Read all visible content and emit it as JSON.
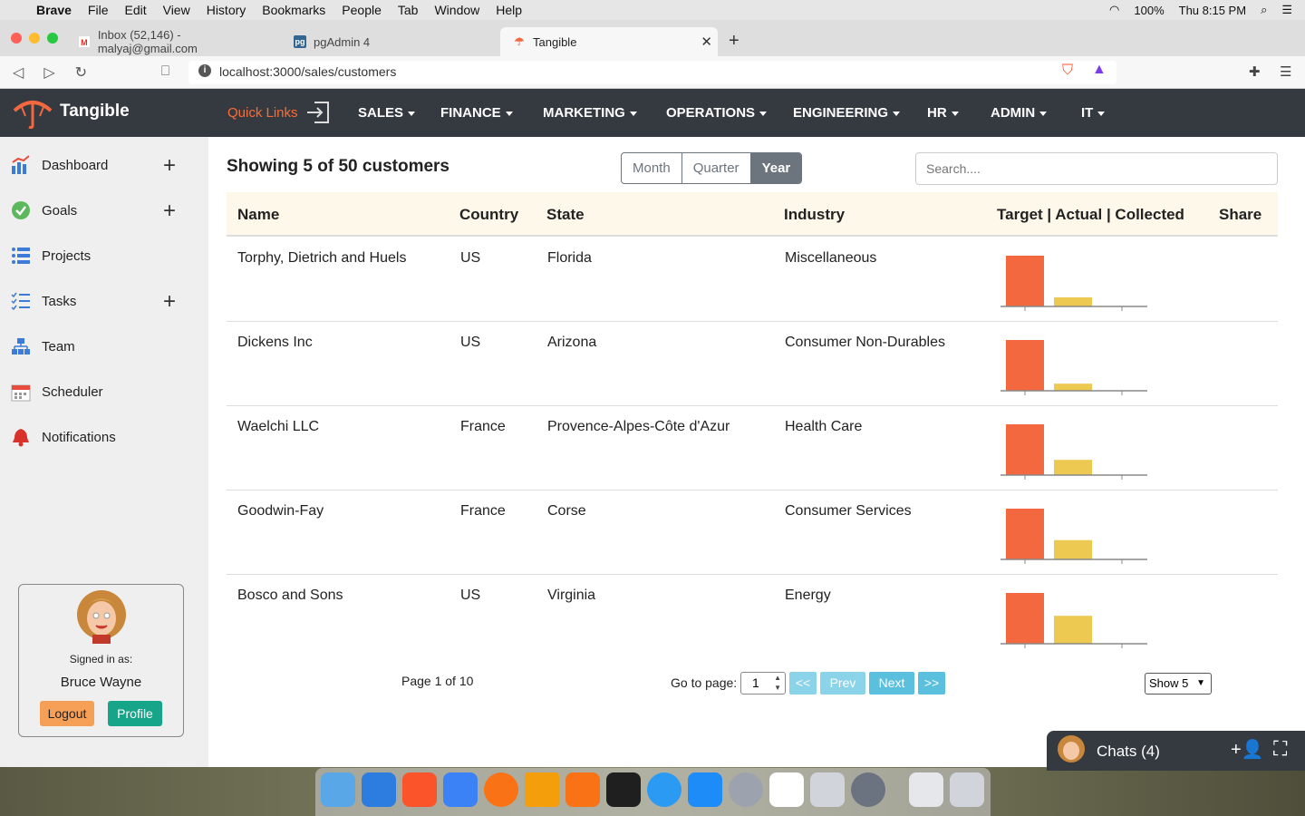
{
  "os_menubar": {
    "app": "Brave",
    "items": [
      "File",
      "Edit",
      "View",
      "History",
      "Bookmarks",
      "People",
      "Tab",
      "Window",
      "Help"
    ],
    "battery": "100%",
    "clock": "Thu 8:15 PM"
  },
  "browser": {
    "tabs": [
      {
        "label": "Inbox (52,146) - malyaj@gmail.com",
        "icon": "gmail-icon"
      },
      {
        "label": "pgAdmin 4",
        "icon": "pgadmin-icon"
      },
      {
        "label": "Tangible",
        "icon": "tangible-icon"
      }
    ],
    "url": "localhost:3000/sales/customers"
  },
  "app": {
    "brand": "Tangible",
    "quick_links": "Quick Links",
    "menus": [
      "SALES",
      "FINANCE",
      "MARKETING",
      "OPERATIONS",
      "ENGINEERING",
      "HR",
      "ADMIN",
      "IT"
    ]
  },
  "sidebar": {
    "items": [
      {
        "label": "Dashboard",
        "icon": "dashboard-icon",
        "plus": true
      },
      {
        "label": "Goals",
        "icon": "goals-check-icon",
        "plus": true
      },
      {
        "label": "Projects",
        "icon": "projects-icon",
        "plus": false
      },
      {
        "label": "Tasks",
        "icon": "tasks-icon",
        "plus": true
      },
      {
        "label": "Team",
        "icon": "team-icon",
        "plus": false
      },
      {
        "label": "Scheduler",
        "icon": "calendar-icon",
        "plus": false
      },
      {
        "label": "Notifications",
        "icon": "bell-icon",
        "plus": false
      }
    ],
    "user": {
      "signed_in_as": "Signed in as:",
      "name": "Bruce Wayne",
      "logout": "Logout",
      "profile": "Profile"
    }
  },
  "main": {
    "heading": "Showing 5 of 50 customers",
    "period": {
      "options": [
        "Month",
        "Quarter",
        "Year"
      ],
      "selected": "Year"
    },
    "search_placeholder": "Search....",
    "columns": [
      "Name",
      "Country",
      "State",
      "Industry",
      "Target | Actual | Collected",
      "Share"
    ],
    "rows": [
      {
        "name": "Torphy, Dietrich and Huels",
        "country": "US",
        "state": "Florida",
        "industry": "Miscellaneous",
        "chart": [
          1.0,
          0.18,
          0
        ]
      },
      {
        "name": "Dickens Inc",
        "country": "US",
        "state": "Arizona",
        "industry": "Consumer Non-Durables",
        "chart": [
          1.0,
          0.14,
          0
        ]
      },
      {
        "name": "Waelchi LLC",
        "country": "France",
        "state": "Provence-Alpes-Côte d'Azur",
        "industry": "Health Care",
        "chart": [
          1.0,
          0.3,
          0
        ]
      },
      {
        "name": "Goodwin-Fay",
        "country": "France",
        "state": "Corse",
        "industry": "Consumer Services",
        "chart": [
          1.0,
          0.38,
          0
        ]
      },
      {
        "name": "Bosco and Sons",
        "country": "US",
        "state": "Virginia",
        "industry": "Energy",
        "chart": [
          1.0,
          0.55,
          0
        ]
      }
    ],
    "chart_colors": {
      "target": "#f4683f",
      "actual": "#edc951",
      "collected": "#6abf69"
    },
    "pagination": {
      "page_info": "Page 1 of 10",
      "goto_label": "Go to page:",
      "page_value": "1",
      "first": "<<",
      "prev": "Prev",
      "next": "Next",
      "last": ">>",
      "show": "Show 5"
    }
  },
  "chat": {
    "label": "Chats (4)"
  }
}
